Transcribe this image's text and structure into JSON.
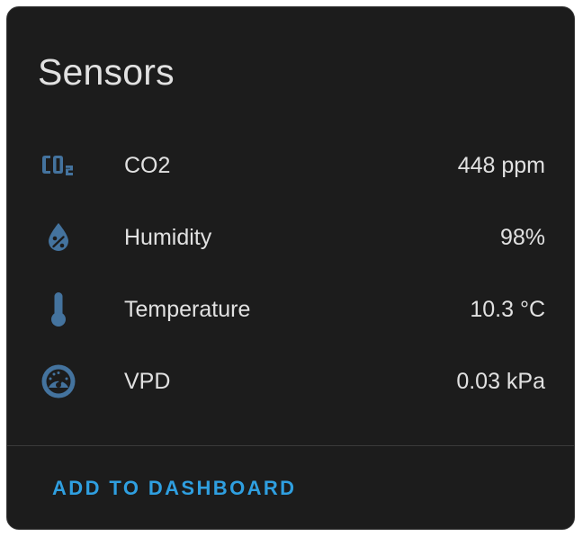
{
  "card": {
    "title": "Sensors"
  },
  "sensors": [
    {
      "icon": "co2-icon",
      "label": "CO2",
      "value": "448 ppm"
    },
    {
      "icon": "water-percent-icon",
      "label": "Humidity",
      "value": "98%"
    },
    {
      "icon": "thermometer-icon",
      "label": "Temperature",
      "value": "10.3 °C"
    },
    {
      "icon": "gauge-icon",
      "label": "VPD",
      "value": "0.03 kPa"
    }
  ],
  "actions": {
    "add_to_dashboard": "ADD TO DASHBOARD"
  },
  "colors": {
    "background": "#1c1c1c",
    "text": "#e1e1e1",
    "icon": "#44739e",
    "accent": "#2f9fe0",
    "divider": "#3a3a3a"
  }
}
